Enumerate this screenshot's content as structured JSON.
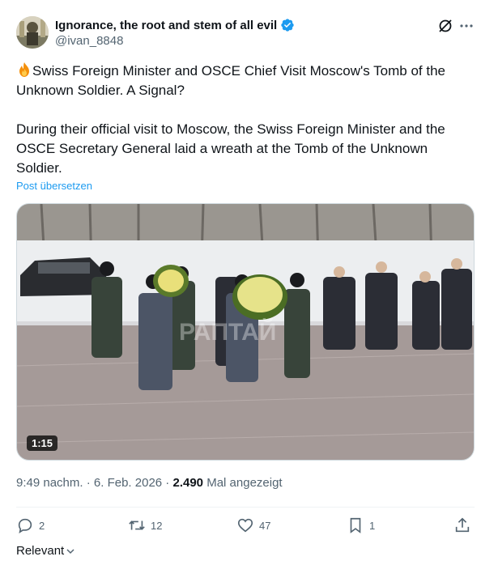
{
  "author": {
    "display_name": "Ignorance, the root and stem of all evil",
    "handle": "@ivan_8848",
    "verified": true,
    "avatar_icon": "avatar-image"
  },
  "post": {
    "headline": "Swiss Foreign Minister and OSCE Chief Visit Moscow's Tomb of the Unknown Soldier. A Signal?",
    "body": "During their official visit to Moscow, the Swiss Foreign Minister and the OSCE Secretary General laid a wreath at the Tomb of the Unknown Soldier.",
    "translate_label": "Post übersetzen"
  },
  "media": {
    "duration": "1:15",
    "watermark": "PAПTAЙ"
  },
  "meta": {
    "time": "9:49 nachm.",
    "date": "6. Feb. 2026",
    "views_count": "2.490",
    "views_label": "Mal angezeigt"
  },
  "actions": {
    "replies": "2",
    "reposts": "12",
    "likes": "47",
    "bookmarks": "1"
  },
  "sort": {
    "label": "Relevant"
  },
  "colors": {
    "link": "#1d9bf0",
    "secondary_text": "#536471",
    "verified": "#1d9bf0"
  }
}
